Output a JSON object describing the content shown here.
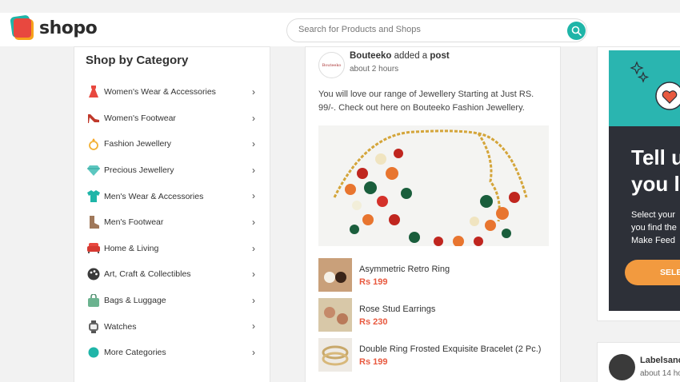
{
  "header": {
    "logo_text": "shopo",
    "search_placeholder": "Search for Products and Shops"
  },
  "sidebar": {
    "title": "Shop by Category",
    "items": [
      {
        "label": "Women's Wear & Accessories",
        "icon": "dress-icon"
      },
      {
        "label": "Women's Footwear",
        "icon": "heel-icon"
      },
      {
        "label": "Fashion Jewellery",
        "icon": "ring-icon"
      },
      {
        "label": "Precious Jewellery",
        "icon": "diamond-icon"
      },
      {
        "label": "Men's Wear & Accessories",
        "icon": "shirt-icon"
      },
      {
        "label": "Men's Footwear",
        "icon": "boot-icon"
      },
      {
        "label": "Home & Living",
        "icon": "sofa-icon"
      },
      {
        "label": "Art, Craft & Collectibles",
        "icon": "palette-icon"
      },
      {
        "label": "Bags & Luggage",
        "icon": "bag-icon"
      },
      {
        "label": "Watches",
        "icon": "watch-icon"
      },
      {
        "label": "More Categories",
        "icon": "dot-icon"
      }
    ]
  },
  "feed": {
    "poster_name": "Bouteeko",
    "action_text": "added a",
    "action_object": "post",
    "avatar_text": "Bouteeko",
    "time": "about 2 hours",
    "text": "You will love our range of Jewellery Starting at Just RS. 99/-. Check out here on Bouteeko Fashion Jewellery.",
    "products": [
      {
        "name": "Asymmetric Retro Ring",
        "price": "Rs 199"
      },
      {
        "name": "Rose Stud Earrings",
        "price": "Rs 230"
      },
      {
        "name": "Double Ring Frosted Exquisite Bracelet (2 Pc.)",
        "price": "Rs 199"
      }
    ]
  },
  "promo": {
    "heading_line1": "Tell u",
    "heading_line2": "you l",
    "text_line1": "Select your",
    "text_line2": "you find the",
    "text_line3": "Make Feed",
    "button": "SELE"
  },
  "card2": {
    "name": "Labelsanc",
    "time": "about 14 ho"
  },
  "colors": {
    "accent": "#1fb5a8",
    "price": "#e8593f",
    "promo_dark": "#2d3038",
    "promo_teal": "#2ab5b0",
    "promo_button": "#f29a3f"
  }
}
